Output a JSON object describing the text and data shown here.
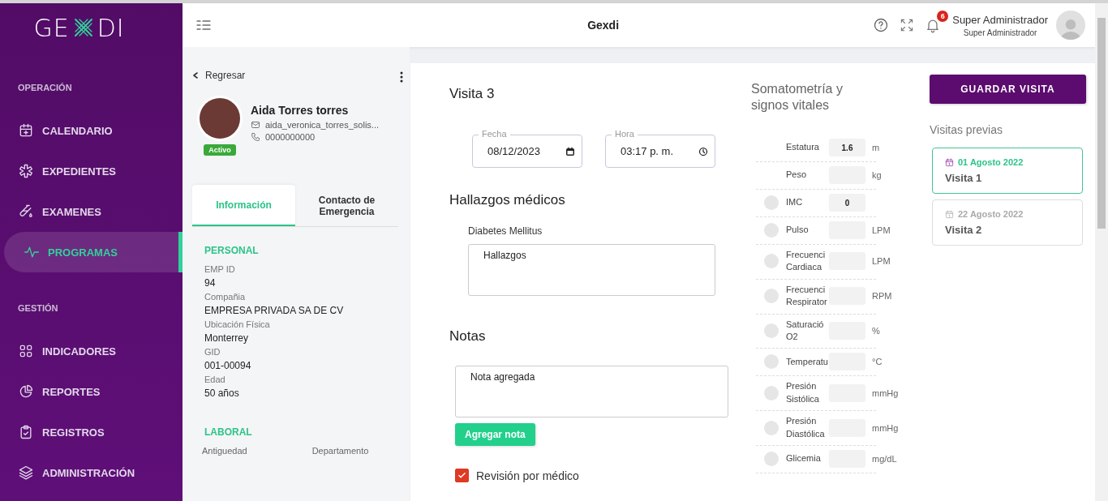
{
  "sidebar": {
    "logo": "GE DI",
    "sections": [
      {
        "title": "OPERACIÓN",
        "items": [
          {
            "label": "CALENDARIO",
            "selected": false
          },
          {
            "label": "EXPEDIENTES",
            "selected": false
          },
          {
            "label": "EXAMENES",
            "selected": false
          },
          {
            "label": "PROGRAMAS",
            "selected": true
          }
        ]
      },
      {
        "title": "GESTIÓN",
        "items": [
          {
            "label": "INDICADORES",
            "selected": false
          },
          {
            "label": "REPORTES",
            "selected": false
          },
          {
            "label": "REGISTROS",
            "selected": false
          },
          {
            "label": "ADMINISTRACIÓN",
            "selected": false
          }
        ]
      }
    ]
  },
  "header": {
    "title": "Gexdi",
    "notifications": "6",
    "user_name": "Super Administrador",
    "user_role": "Super Administrador"
  },
  "patient": {
    "back": "Regresar",
    "name": "Aida Torres torres",
    "email": "aida_veronica_torres_solis...",
    "phone": "0000000000",
    "status": "Activo",
    "tabs": [
      {
        "label": "Información",
        "selected": true
      },
      {
        "label": "Contacto de Emergencia",
        "selected": false
      }
    ],
    "personal_title": "PERSONAL",
    "fields": [
      {
        "label": "EMP ID",
        "value": "94"
      },
      {
        "label": "Compañia",
        "value": "EMPRESA PRIVADA SA DE CV"
      },
      {
        "label": "Ubicación Física",
        "value": "Monterrey"
      },
      {
        "label": "GID",
        "value": "001-00094"
      },
      {
        "label": "Edad",
        "value": "50 años"
      }
    ],
    "laboral_title": "LABORAL",
    "laboral_labels": [
      "Antiguedad",
      "Departamento"
    ]
  },
  "visit": {
    "title": "Visita 3",
    "date_label": "Fecha",
    "date": "08/12/2023",
    "time_label": "Hora",
    "time": "03:17 p. m.",
    "findings_title": "Hallazgos médicos",
    "finding_label": "Diabetes Mellitus",
    "findings_value": "Hallazgos",
    "notes_title": "Notas",
    "note_value": "Nota agregada",
    "add_note": "Agregar nota",
    "review": {
      "label": "Revisión por médico",
      "checked": true
    }
  },
  "vitals": {
    "title": "Somatometría y signos vitales",
    "rows": [
      {
        "kind": "plain",
        "label": "Estatura",
        "value": "1.6",
        "unit": "m"
      },
      {
        "kind": "plain",
        "label": "Peso",
        "unit": "kg"
      },
      {
        "kind": "dot",
        "label": "IMC",
        "value": "0"
      },
      {
        "kind": "dot",
        "label": "Pulso",
        "unit": "LPM"
      },
      {
        "kind": "dot",
        "label": "Frecuenci Cardiaca",
        "unit": "LPM"
      },
      {
        "kind": "dot",
        "label": "Frecuenci Respirator",
        "unit": "RPM"
      },
      {
        "kind": "dot",
        "label": "Saturació O2",
        "unit": "%"
      },
      {
        "kind": "dot",
        "label": "Temperatu",
        "unit": "°C"
      },
      {
        "kind": "dot",
        "label": "Presión Sistólica",
        "unit": "mmHg"
      },
      {
        "kind": "dot",
        "label": "Presión Diastólica",
        "unit": "mmHg"
      },
      {
        "kind": "dot",
        "label": "Glicemia",
        "unit": "mg/dL"
      }
    ]
  },
  "save_button": "GUARDAR VISITA",
  "previous": {
    "title": "Visitas previas",
    "visits": [
      {
        "date": "01 Agosto 2022",
        "name": "Visita 1",
        "selected": true
      },
      {
        "date": "22 Agosto 2022",
        "name": "Visita 2",
        "selected": false
      }
    ]
  }
}
